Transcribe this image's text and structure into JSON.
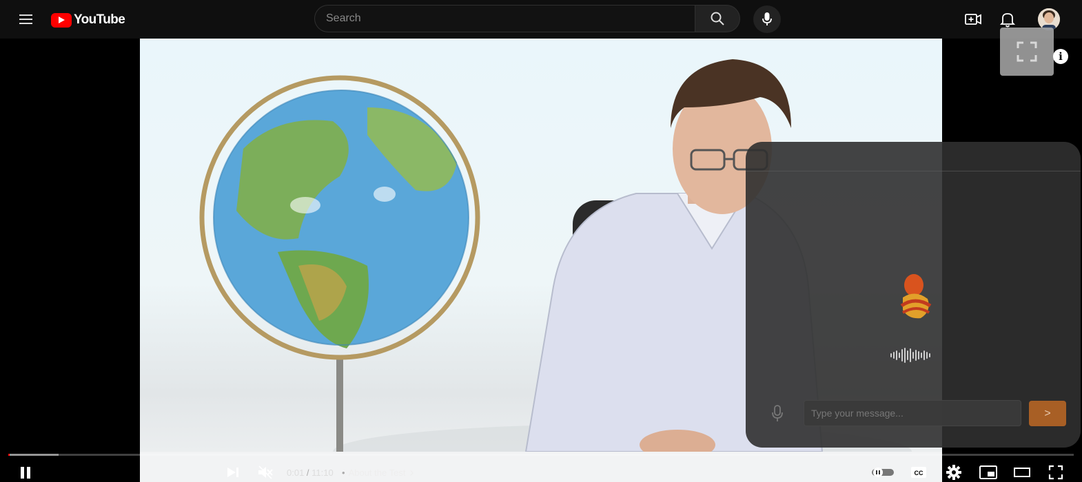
{
  "header": {
    "logo_text": "YouTube",
    "search_placeholder": "Search"
  },
  "chat": {
    "input_placeholder": "Type your message...",
    "send_glyph": ">"
  },
  "player": {
    "progress_fraction": 0.0016,
    "buffered_fraction": 0.047,
    "current_time": "0:01",
    "time_separator": " / ",
    "duration": "11:10",
    "chapter_bullet": "•",
    "chapter_title": "About the Test",
    "chapter_arrow": "›"
  },
  "colors": {
    "accent": "#ff0000",
    "chat_send": "#a85f25"
  }
}
